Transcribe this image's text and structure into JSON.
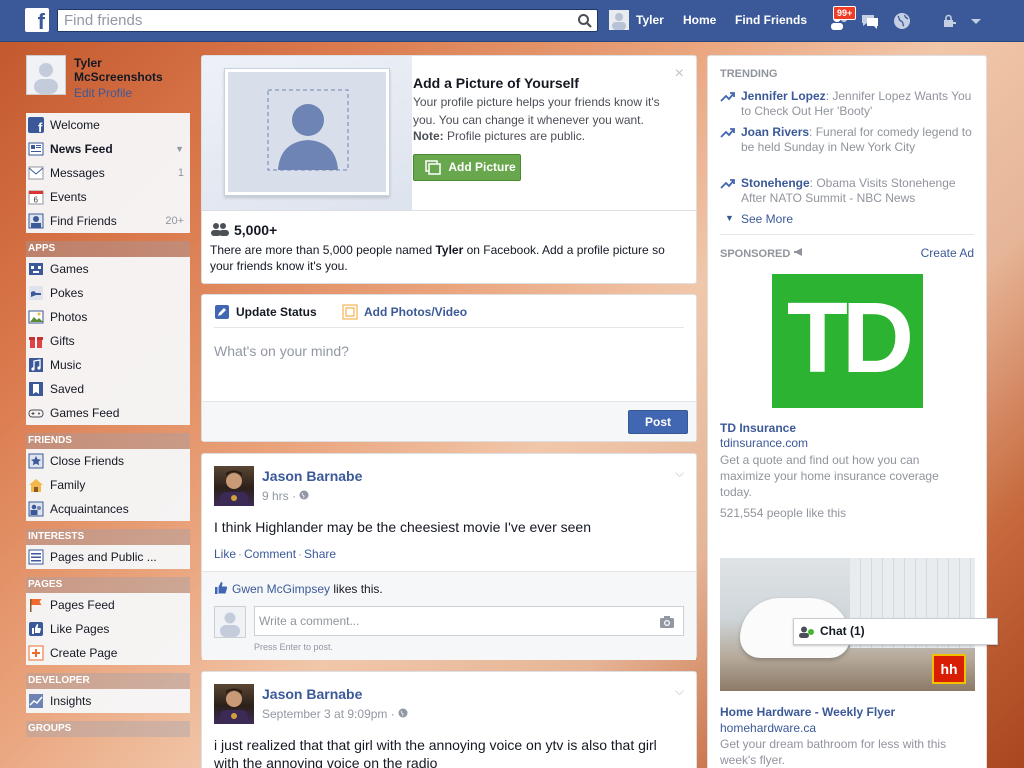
{
  "topbar": {
    "logo": "f",
    "search_placeholder": "Find friends",
    "user_name": "Tyler",
    "home": "Home",
    "find_friends": "Find Friends",
    "notifications_badge": "99+"
  },
  "profile": {
    "name": "Tyler McScreenshots",
    "edit": "Edit Profile"
  },
  "nav_main": [
    {
      "label": "Welcome",
      "icon": "fb-icon"
    },
    {
      "label": "News Feed",
      "icon": "newsfeed-icon"
    },
    {
      "label": "Messages",
      "icon": "messages-icon",
      "count": "1"
    },
    {
      "label": "Events",
      "icon": "calendar-icon"
    },
    {
      "label": "Find Friends",
      "icon": "find-friends-icon",
      "count": "20+"
    }
  ],
  "nav_sections": {
    "apps": "APPS",
    "friends": "FRIENDS",
    "interests": "INTERESTS",
    "pages": "PAGES",
    "developer": "DEVELOPER",
    "groups": "GROUPS"
  },
  "nav_apps": [
    "Games",
    "Pokes",
    "Photos",
    "Gifts",
    "Music",
    "Saved",
    "Games Feed"
  ],
  "nav_friends": [
    "Close Friends",
    "Family",
    "Acquaintances"
  ],
  "nav_interests": [
    "Pages and Public ..."
  ],
  "nav_pages": [
    "Pages Feed",
    "Like Pages",
    "Create Page"
  ],
  "nav_developer": [
    "Insights"
  ],
  "add_picture": {
    "title": "Add a Picture of Yourself",
    "text": "Your profile picture helps your friends know it's you. You can change it whenever you want.",
    "note_label": "Note:",
    "note_text": "Profile pictures are public.",
    "button": "Add Picture",
    "close": "×",
    "count": "5,000+",
    "desc_pre": "There are more than 5,000 people named ",
    "desc_name": "Tyler",
    "desc_post": " on Facebook. Add a profile picture so your friends know it's you."
  },
  "composer": {
    "tab_status": "Update Status",
    "tab_photos": "Add Photos/Video",
    "placeholder": "What's on your mind?",
    "post_button": "Post"
  },
  "posts": [
    {
      "author": "Jason Barnabe",
      "time": "9 hrs · ",
      "text": "I think Highlander may be the cheesiest movie I've ever seen",
      "like": "Like",
      "comment": "Comment",
      "share": "Share",
      "liker": "Gwen McGimpsey",
      "likes_suffix": " likes this.",
      "comment_placeholder": "Write a comment...",
      "press_enter": "Press Enter to post."
    },
    {
      "author": "Jason Barnabe",
      "time": "September 3 at 9:09pm · ",
      "text": "i just realized that that girl with the annoying voice on ytv is also that girl with the annoying voice on the radio"
    }
  ],
  "trending": {
    "heading": "TRENDING",
    "items": [
      {
        "name": "Jennifer Lopez",
        "text": ": Jennifer Lopez Wants You to Check Out Her 'Booty'"
      },
      {
        "name": "Joan Rivers",
        "text": ": Funeral for comedy legend to be held Sunday in New York City"
      },
      {
        "name": "Stonehenge",
        "text": ": Obama Visits Stonehenge After NATO Summit - NBC News"
      }
    ],
    "see_more": "See More"
  },
  "sponsored": {
    "heading": "SPONSORED",
    "create_ad": "Create Ad",
    "ad1": {
      "logo": "TD",
      "title": "TD Insurance",
      "domain": "tdinsurance.com",
      "desc": "Get a quote and find out how you can maximize your home insurance coverage today.",
      "likes": "521,554 people like this"
    },
    "ad2": {
      "logo": "hh",
      "title": "Home Hardware - Weekly Flyer",
      "domain": "homehardware.ca",
      "desc": "Get your dream bathroom for less with this week's flyer."
    }
  },
  "chat": {
    "label": "Chat (1)"
  }
}
